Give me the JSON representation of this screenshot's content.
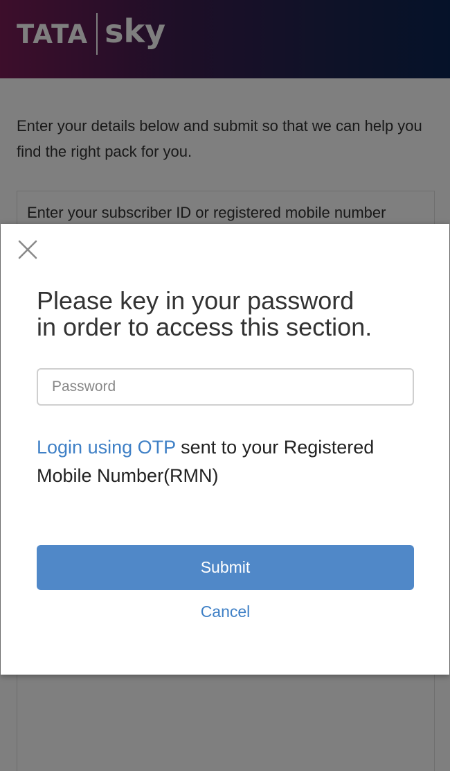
{
  "header": {
    "logo_left": "TATA",
    "logo_right": "sky",
    "gradient_start": "#7a1c57",
    "gradient_end": "#0b2552"
  },
  "page": {
    "intro_text": "Enter your details below and submit so that we can help you find the right pack for you.",
    "form_label": "Enter your subscriber ID or registered mobile number"
  },
  "modal": {
    "close_icon": "close-icon",
    "title_line1": "Please key in your password",
    "title_line2": "in order to access this section.",
    "password_placeholder": "Password",
    "password_value": "",
    "otp_link_label": "Login using OTP",
    "otp_rest_text": " sent to your Registered Mobile Number(RMN)",
    "submit_label": "Submit",
    "cancel_label": "Cancel",
    "accent_color": "#5088c8",
    "link_color": "#3f80c6"
  }
}
